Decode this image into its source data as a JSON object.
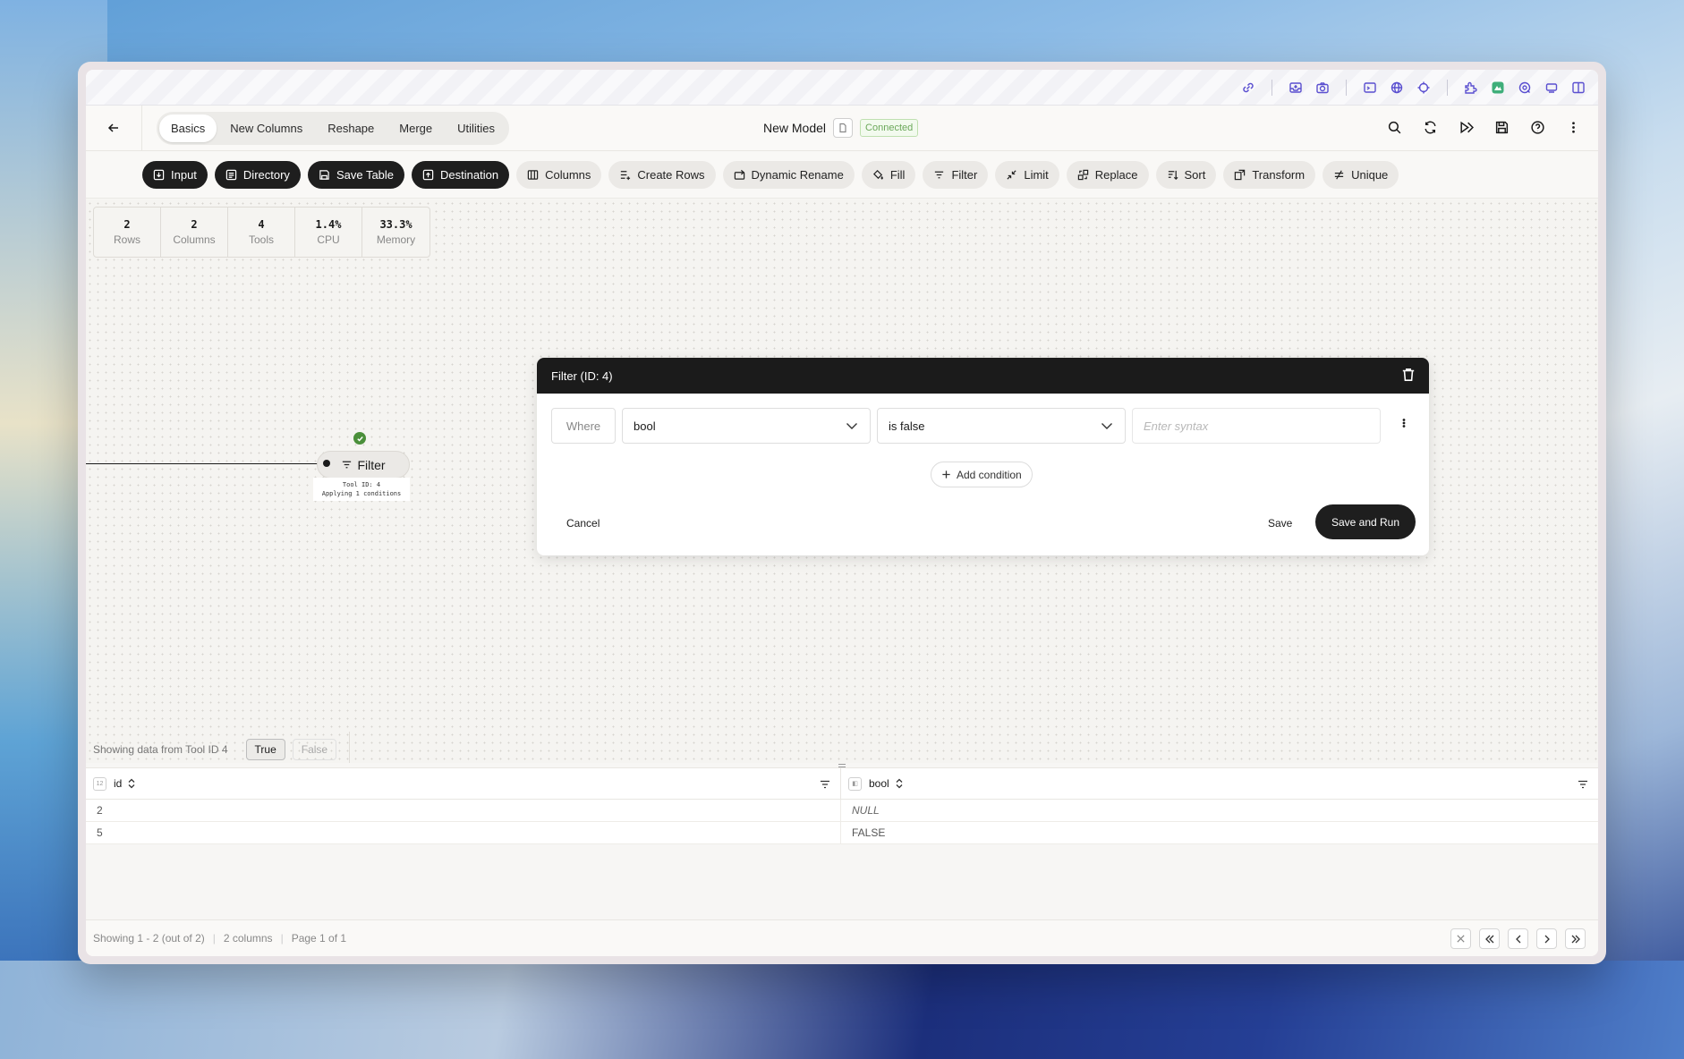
{
  "header": {
    "tabs": [
      {
        "label": "Basics",
        "active": true
      },
      {
        "label": "New Columns"
      },
      {
        "label": "Reshape"
      },
      {
        "label": "Merge"
      },
      {
        "label": "Utilities"
      }
    ],
    "model_title": "New Model",
    "status_badge": "Connected",
    "actions": [
      "search-icon",
      "refresh-icon",
      "run-icon",
      "save-icon",
      "help-icon",
      "more-vertical-icon"
    ]
  },
  "sysbar_icons": [
    "link-icon",
    "inbox-icon",
    "camera-icon",
    "terminal-icon",
    "globe-icon",
    "crosshair-icon",
    "extension-icon",
    "app-icon",
    "vpn-icon",
    "display-icon",
    "sidebar-icon"
  ],
  "toolbar": {
    "tools": [
      {
        "label": "Input",
        "dark": true,
        "icon": "input-icon"
      },
      {
        "label": "Directory",
        "dark": true,
        "icon": "directory-icon"
      },
      {
        "label": "Save Table",
        "dark": true,
        "icon": "save-table-icon"
      },
      {
        "label": "Destination",
        "dark": true,
        "icon": "destination-icon"
      },
      {
        "label": "Columns",
        "icon": "columns-icon"
      },
      {
        "label": "Create Rows",
        "icon": "create-rows-icon"
      },
      {
        "label": "Dynamic Rename",
        "icon": "dynamic-rename-icon"
      },
      {
        "label": "Fill",
        "icon": "fill-icon"
      },
      {
        "label": "Filter",
        "icon": "filter-icon"
      },
      {
        "label": "Limit",
        "icon": "limit-icon"
      },
      {
        "label": "Replace",
        "icon": "replace-icon"
      },
      {
        "label": "Sort",
        "icon": "sort-icon"
      },
      {
        "label": "Transform",
        "icon": "transform-icon"
      },
      {
        "label": "Unique",
        "icon": "unique-icon"
      }
    ]
  },
  "stats": [
    {
      "value": "2",
      "label": "Rows"
    },
    {
      "value": "2",
      "label": "Columns"
    },
    {
      "value": "4",
      "label": "Tools"
    },
    {
      "value": "1.4%",
      "label": "CPU"
    },
    {
      "value": "33.3%",
      "label": "Memory"
    }
  ],
  "node": {
    "label": "Filter",
    "meta_line1": "Tool ID: 4",
    "meta_line2": "Applying 1 conditions"
  },
  "dialog": {
    "title": "Filter (ID: 4)",
    "where_label": "Where",
    "column_value": "bool",
    "operator_value": "is false",
    "syntax_placeholder": "Enter syntax",
    "add_condition_label": "Add condition",
    "cancel_label": "Cancel",
    "save_label": "Save",
    "save_run_label": "Save and Run"
  },
  "data_panel": {
    "showing_text": "Showing data from Tool ID 4",
    "true_label": "True",
    "false_label": "False",
    "columns": [
      {
        "name": "id"
      },
      {
        "name": "bool"
      }
    ],
    "rows": [
      {
        "id": "2",
        "bool": "NULL"
      },
      {
        "id": "5",
        "bool": "FALSE"
      }
    ]
  },
  "footer": {
    "showing": "Showing 1 - 2 (out of 2)",
    "columns": "2 columns",
    "page": "Page 1 of 1"
  },
  "colors": {
    "dark_button": "#1e1e1e",
    "status_green": "#6ba85a",
    "accent_purple": "#5a4fd0"
  }
}
